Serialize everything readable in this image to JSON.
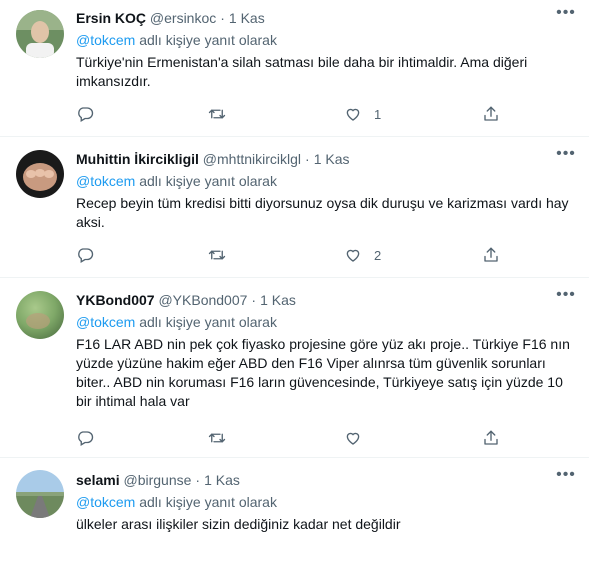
{
  "tweets": [
    {
      "name": "Ersin KOÇ",
      "handle": "@ersinkoc",
      "dot": "·",
      "time": "1 Kas",
      "reply_mention": "@tokcem",
      "reply_suffix": " adlı kişiye yanıt olarak",
      "text": "Türkiye'nin Ermenistan'a silah satması bile daha bir ihtimaldir. Ama diğeri imkansızdır.",
      "likes": "1"
    },
    {
      "name": "Muhittin İkircikligil",
      "handle": "@mhttnikirciklgl",
      "dot": "·",
      "time": "1 Kas",
      "reply_mention": "@tokcem",
      "reply_suffix": " adlı kişiye yanıt olarak",
      "text": "Recep beyin tüm kredisi bitti diyorsunuz oysa dik duruşu ve karizması vardı hay aksi.",
      "likes": "2"
    },
    {
      "name": "YKBond007",
      "handle": "@YKBond007",
      "dot": "·",
      "time": "1 Kas",
      "reply_mention": "@tokcem",
      "reply_suffix": " adlı kişiye yanıt olarak",
      "text": "F16 LAR ABD nin pek çok fiyasko projesine göre yüz akı proje.. Türkiye F16 nın yüzde yüzüne hakim eğer ABD den F16 Viper alınrsa tüm güvenlik sorunları biter.. ABD nin koruması F16 ların güvencesinde, Türkiyeye satış için yüzde 10 bir ihtimal hala var",
      "likes": ""
    },
    {
      "name": "selami",
      "handle": "@birgunse",
      "dot": "·",
      "time": "1 Kas",
      "reply_mention": "@tokcem",
      "reply_suffix": " adlı kişiye yanıt olarak",
      "text": "ülkeler arası ilişkiler sizin dediğiniz kadar net değildir",
      "likes": ""
    }
  ],
  "more_glyph": "•••",
  "colors": {
    "accent": "#1d9bf0",
    "secondary_text": "#536471",
    "divider": "#eff3f4"
  }
}
